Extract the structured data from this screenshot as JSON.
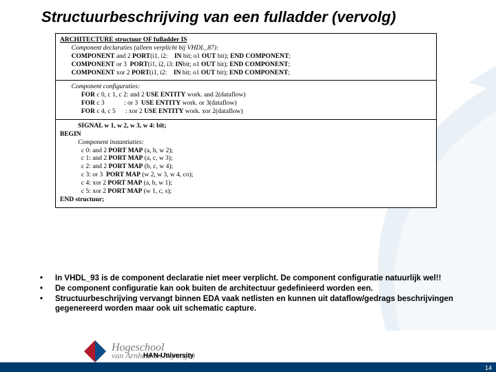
{
  "title": "Structuurbeschrijving van een fulladder (vervolg)",
  "code": {
    "block1": {
      "l0": "ARCHITECTURE structuur OF fulladder IS",
      "l1": "Component declaraties (alleen verplicht bij VHDL_87):",
      "l2a": "COMPONENT",
      "l2b": " and 2 ",
      "l2c": "PORT",
      "l2d": "(i1, i2:    ",
      "l2e": "IN",
      "l2f": " bit; o1 ",
      "l2g": "OUT",
      "l2h": " bit); ",
      "l2i": "END COMPONENT",
      "l2j": ";",
      "l3a": "COMPONENT",
      "l3b": " or 3  ",
      "l3c": "PORT",
      "l3d": "(i1, i2, i3: ",
      "l3e": "IN",
      "l3f": "bit; o1 ",
      "l3g": "OUT",
      "l3h": " bit); ",
      "l3i": "END COMPONENT",
      "l3j": ";",
      "l4a": "COMPONENT",
      "l4b": " xor 2 ",
      "l4c": "PORT",
      "l4d": "(i1, i2:    ",
      "l4e": "IN",
      "l4f": " bit; o1 ",
      "l4g": "OUT",
      "l4h": " bit); ",
      "l4i": "END COMPONENT",
      "l4j": ";"
    },
    "block2": {
      "l0": "Component configuraties:",
      "l1a": "FOR",
      "l1b": " c 0, c 1, c 2: and 2 ",
      "l1c": "USE ENTITY",
      "l1d": " work. and 2(dataflow)",
      "l2a": "FOR",
      "l2b": " c 3            : or 3  ",
      "l2c": "USE ENTITY",
      "l2d": " work. or 3(dataflow)",
      "l3a": "FOR",
      "l3b": " c 4, c 5      : xor 2 ",
      "l3c": "USE ENTITY",
      "l3d": " work. xor 2(dataflow)"
    },
    "block3": {
      "l0": "SIGNAL w 1, w 2, w 3, w 4: bit;",
      "l1": "BEGIN",
      "l2": "Component instantiaties:",
      "l3a": "c 0: and 2 ",
      "l3b": "PORT MAP",
      "l3c": " (a, b, w 2);",
      "l4a": "c 1: and 2 ",
      "l4b": "PORT MAP",
      "l4c": " (a, c, w 3);",
      "l5a": "c 2: and 2 ",
      "l5b": "PORT MAP",
      "l5c": " (b, c, w 4);",
      "l6a": "c 3: or 3  ",
      "l6b": "PORT MAP",
      "l6c": " (w 2, w 3, w 4, co);",
      "l7a": "c 4: xor 2 ",
      "l7b": "PORT MAP",
      "l7c": " (a, b, w 1);",
      "l8a": "c 5: xor 2 ",
      "l8b": "PORT MAP",
      "l8c": " (w 1, c, s);",
      "l9": "END structuur;"
    }
  },
  "bullets": {
    "b1": "In VHDL_93 is de component declaratie niet meer verplicht. De component configuratie natuurlijk wel!!",
    "b2": "De component configuratie kan ook buiten de architectuur gedefinieerd worden een.",
    "b3": "Structuurbeschrijving vervangt binnen EDA vaak netlisten en kunnen uit dataflow/gedrags beschrijvingen gegenereerd worden maar ook uit schematic capture."
  },
  "footer": {
    "logo_text": "van Arnhem en Nijmegen",
    "school": "Hogeschool",
    "uni": "HAN-University",
    "page": "14"
  }
}
